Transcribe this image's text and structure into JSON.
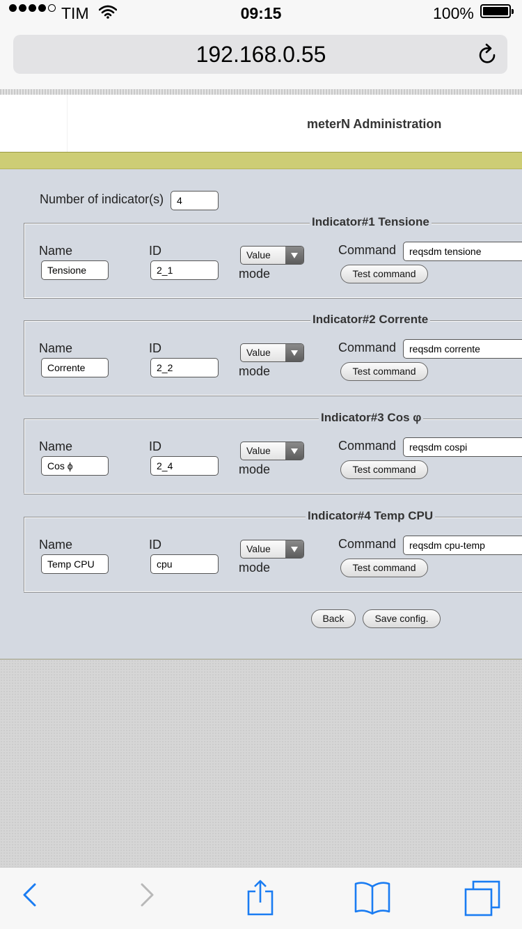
{
  "status_bar": {
    "carrier": "TIM",
    "time": "09:15",
    "battery": "100%"
  },
  "browser": {
    "url": "192.168.0.55"
  },
  "site": {
    "title": "meterN Administration"
  },
  "form": {
    "num_indicators_label": "Number of indicator(s)",
    "num_indicators_value": "4",
    "field_labels": {
      "name": "Name",
      "id": "ID",
      "command": "Command",
      "mode": "mode"
    },
    "indicators": [
      {
        "legend": "Indicator#1 Tensione",
        "name": "Tensione",
        "id": "2_1",
        "mode": "Value",
        "command": "reqsdm tensione",
        "test_label": "Test command"
      },
      {
        "legend": "Indicator#2 Corrente",
        "name": "Corrente",
        "id": "2_2",
        "mode": "Value",
        "command": "reqsdm corrente",
        "test_label": "Test command"
      },
      {
        "legend": "Indicator#3 Cos φ",
        "name": "Cos ϕ",
        "id": "2_4",
        "mode": "Value",
        "command": "reqsdm cospi",
        "test_label": "Test command"
      },
      {
        "legend": "Indicator#4 Temp CPU",
        "name": "Temp CPU",
        "id": "cpu",
        "mode": "Value",
        "command": "reqsdm cpu-temp",
        "test_label": "Test command"
      }
    ],
    "back_label": "Back",
    "save_label": "Save config."
  }
}
